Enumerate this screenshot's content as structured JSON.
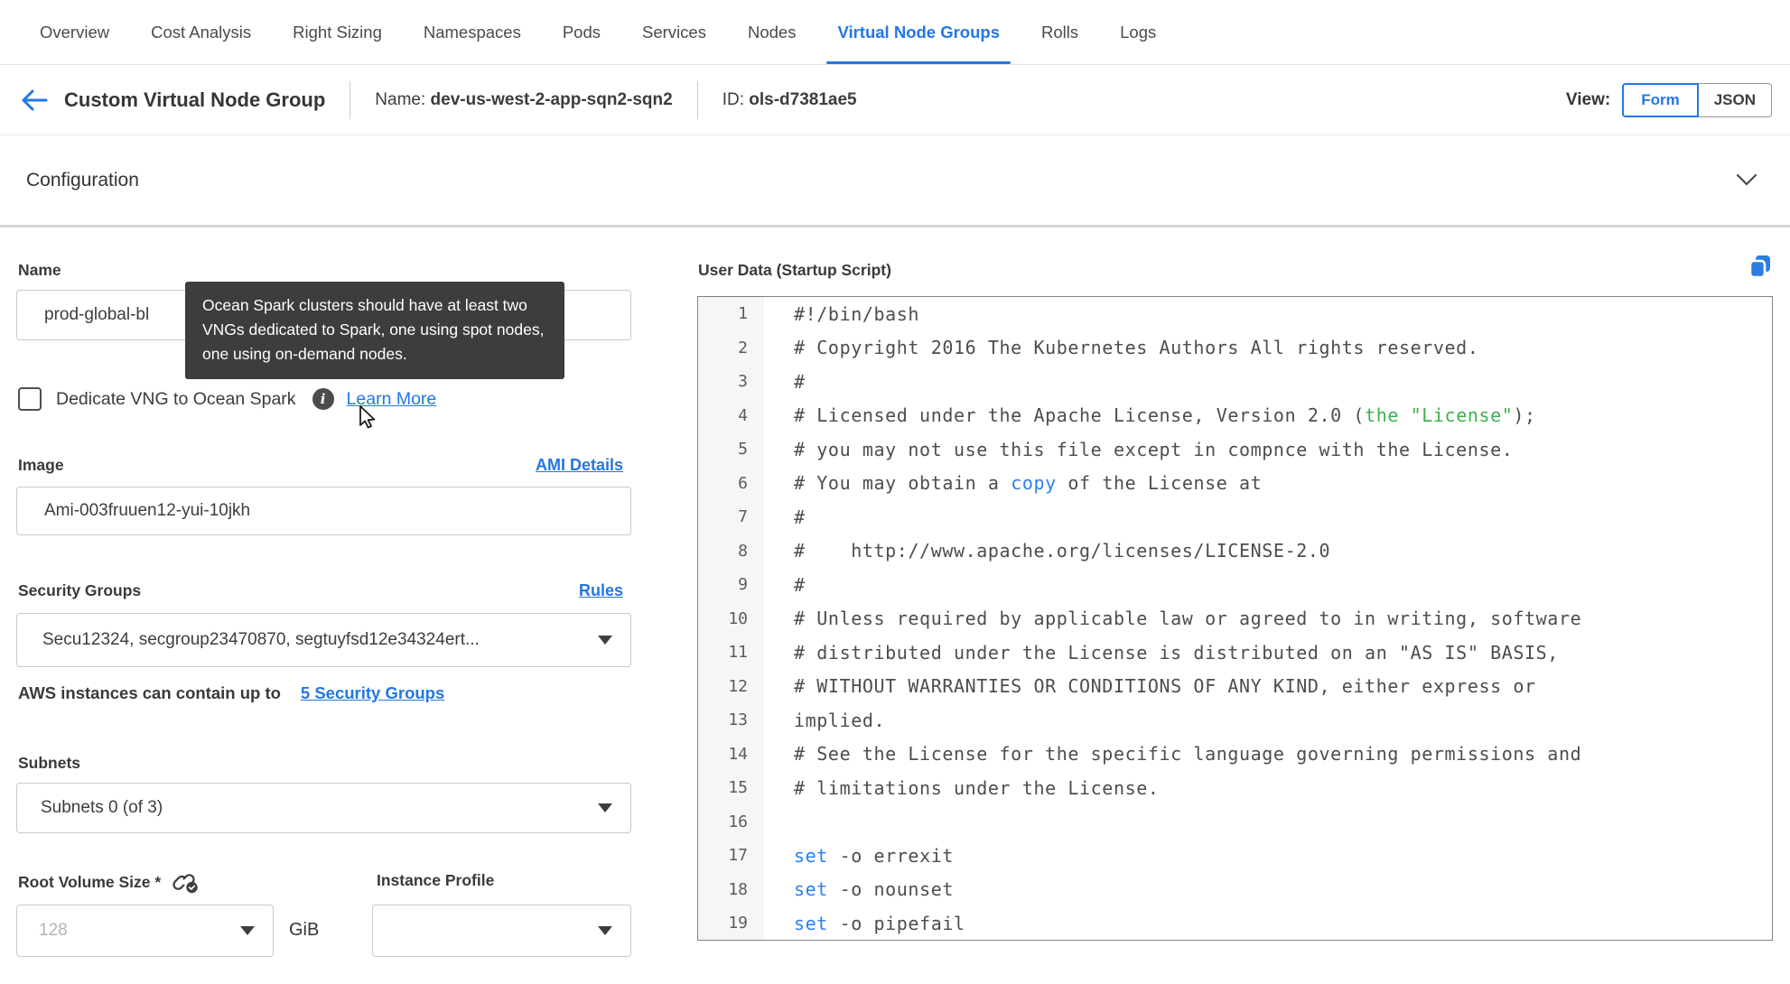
{
  "nav": {
    "tabs": [
      {
        "label": "Overview",
        "active": false
      },
      {
        "label": "Cost Analysis",
        "active": false
      },
      {
        "label": "Right Sizing",
        "active": false
      },
      {
        "label": "Namespaces",
        "active": false
      },
      {
        "label": "Pods",
        "active": false
      },
      {
        "label": "Services",
        "active": false
      },
      {
        "label": "Nodes",
        "active": false
      },
      {
        "label": "Virtual Node Groups",
        "active": true
      },
      {
        "label": "Rolls",
        "active": false
      },
      {
        "label": "Logs",
        "active": false
      }
    ]
  },
  "header": {
    "back_icon": "left-arrow",
    "title": "Custom Virtual Node Group",
    "name_label": "Name:",
    "name_value": "dev-us-west-2-app-sqn2-sqn2",
    "id_label": "ID:",
    "id_value": "ols-d7381ae5",
    "view": {
      "label": "View:",
      "form": "Form",
      "json": "JSON",
      "selected": "Form"
    }
  },
  "configuration": {
    "title": "Configuration",
    "collapse_icon": "chevron-down"
  },
  "form": {
    "name": {
      "label": "Name",
      "value": "prod-global-bl"
    },
    "spark_tooltip": {
      "text": "Ocean Spark clusters should have at least two VNGs dedicated to Spark, one using spot nodes, one using on-demand nodes."
    },
    "dedicate_spark": {
      "label": "Dedicate VNG to Ocean Spark",
      "checked": false,
      "info_icon": "info",
      "learn_more": "Learn More"
    },
    "image": {
      "label": "Image",
      "link": "AMI Details",
      "value": "Ami-003fruuen12-yui-10jkh"
    },
    "security_groups": {
      "label": "Security Groups",
      "link": "Rules",
      "value": "Secu12324, secgroup23470870, segtuyfsd12e34324ert...",
      "note": "AWS instances can contain up to",
      "note_link": "5 Security Groups"
    },
    "subnets": {
      "label": "Subnets",
      "value": "Subnets 0 (of 3)"
    },
    "root_volume_size": {
      "label": "Root Volume Size *",
      "placeholder": "128",
      "unit": "GiB",
      "link_icon": "link-with-check"
    },
    "instance_profile": {
      "label": "Instance Profile",
      "value": ""
    }
  },
  "user_data": {
    "label": "User Data (Startup Script)",
    "copy_icon": "copy",
    "palette": {
      "default": "#4d4d4d",
      "green": "#3cb14c",
      "blue": "#2b7ff2"
    },
    "lines": [
      {
        "num": 1,
        "segments": [
          {
            "text": "#!/bin/bash",
            "color": "default"
          }
        ]
      },
      {
        "num": 2,
        "segments": [
          {
            "text": "# Copyright 2016 The Kubernetes Authors All rights reserved.",
            "color": "default"
          }
        ]
      },
      {
        "num": 3,
        "segments": [
          {
            "text": "#",
            "color": "default"
          }
        ]
      },
      {
        "num": 4,
        "segments": [
          {
            "text": "# Licensed under the Apache License, Version 2.0 (",
            "color": "default"
          },
          {
            "text": "the \"License\"",
            "color": "green"
          },
          {
            "text": ");",
            "color": "default"
          }
        ]
      },
      {
        "num": 5,
        "segments": [
          {
            "text": "# you may not use this file except in compnce with the License.",
            "color": "default"
          }
        ]
      },
      {
        "num": 6,
        "segments": [
          {
            "text": "# You may obtain a ",
            "color": "default"
          },
          {
            "text": "copy",
            "color": "blue"
          },
          {
            "text": " of the License at",
            "color": "default"
          }
        ]
      },
      {
        "num": 7,
        "segments": [
          {
            "text": "#",
            "color": "default"
          }
        ]
      },
      {
        "num": 8,
        "segments": [
          {
            "text": "#    http://www.apache.org/licenses/LICENSE-2.0",
            "color": "default"
          }
        ]
      },
      {
        "num": 9,
        "segments": [
          {
            "text": "#",
            "color": "default"
          }
        ]
      },
      {
        "num": 10,
        "segments": [
          {
            "text": "# Unless required by applicable law or agreed to in writing, software",
            "color": "default"
          }
        ]
      },
      {
        "num": 11,
        "segments": [
          {
            "text": "# distributed under the License is distributed on an \"AS IS\" BASIS,",
            "color": "default"
          }
        ]
      },
      {
        "num": 12,
        "segments": [
          {
            "text": "# WITHOUT WARRANTIES OR CONDITIONS OF ANY KIND, either express or",
            "color": "default"
          }
        ]
      },
      {
        "num": 13,
        "segments": [
          {
            "text": "implied.",
            "color": "default"
          }
        ]
      },
      {
        "num": 14,
        "segments": [
          {
            "text": "# See the License for the specific language governing permissions and",
            "color": "default"
          }
        ]
      },
      {
        "num": 15,
        "segments": [
          {
            "text": "# limitations under the License.",
            "color": "default"
          }
        ]
      },
      {
        "num": 16,
        "segments": []
      },
      {
        "num": 17,
        "segments": [
          {
            "text": "set",
            "color": "blue"
          },
          {
            "text": " -o errexit",
            "color": "default"
          }
        ]
      },
      {
        "num": 18,
        "segments": [
          {
            "text": "set",
            "color": "blue"
          },
          {
            "text": " -o nounset",
            "color": "default"
          }
        ]
      },
      {
        "num": 19,
        "segments": [
          {
            "text": "set",
            "color": "blue"
          },
          {
            "text": " -o pipefail",
            "color": "default"
          }
        ]
      }
    ]
  },
  "colors": {
    "accent_blue": "#2277e6",
    "tooltip_bg": "#3d3d3d",
    "editor_border": "#818181",
    "gutter_bg": "#f6f6f6",
    "code_green": "#3cb14c",
    "code_blue": "#2b7ff2"
  }
}
